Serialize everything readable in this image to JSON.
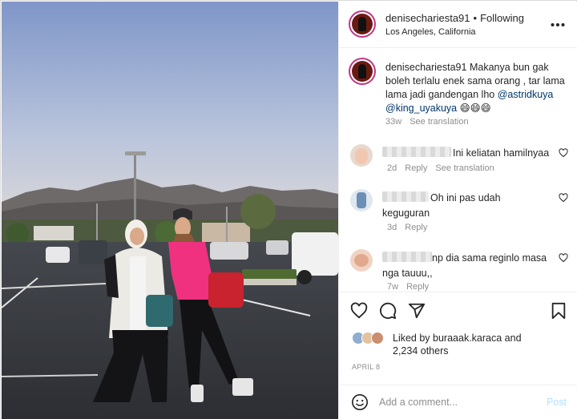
{
  "post": {
    "username": "denisechariesta91",
    "follow_status": "Following",
    "dot": "•",
    "location": "Los Angeles, California",
    "more_icon": "ellipsis-icon"
  },
  "caption": {
    "username": "denisechariesta91",
    "text": "Makanya bun gak boleh terlalu enek sama orang , tar lama lama jadi gandengan lho",
    "mention_1": "@astridkuya",
    "mention_2": "@king_uyakuya",
    "emoji": "😄😄😄",
    "time": "33w",
    "see_translation": "See translation"
  },
  "comments": [
    {
      "text": "Ini keliatan hamilnyaa",
      "time": "2d",
      "reply": "Reply",
      "see_translation": "See translation"
    },
    {
      "text_line1": "Oh ini pas udah",
      "text_line2": "keguguran",
      "time": "3d",
      "reply": "Reply"
    },
    {
      "text_line1": "np dia sama reginlo masa",
      "text_line2": "nga tauuu,,",
      "time": "7w",
      "reply": "Reply"
    }
  ],
  "likes": {
    "prefix": "Liked by ",
    "user": "buraaak.karaca",
    "and": " and",
    "others": "2,234 others"
  },
  "date": "APRIL 8",
  "add_comment": {
    "placeholder": "Add a comment...",
    "post_label": "Post"
  },
  "colors": {
    "link": "#00376b",
    "muted": "#8e8e8e",
    "post_button_disabled": "#b2dffc",
    "sky_top": "#7e95c7",
    "pink_shirt": "#f0317f"
  },
  "icons": [
    "heart-icon",
    "comment-icon",
    "share-icon",
    "bookmark-icon",
    "emoji-icon"
  ]
}
